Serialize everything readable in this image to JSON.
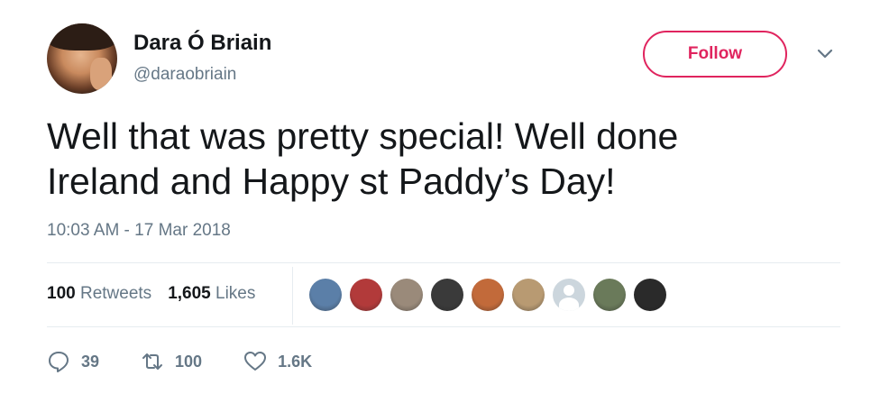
{
  "tweet": {
    "author": {
      "name": "Dara Ó Briain",
      "handle": "@daraobriain"
    },
    "follow_label": "Follow",
    "text_line1": "Well that was pretty special! Well done",
    "text_line2": "Ireland and Happy st Paddy’s Day!",
    "timestamp": "10:03 AM - 17 Mar 2018",
    "stats": {
      "retweets_count": "100",
      "retweets_label": "Retweets",
      "likes_count": "1,605",
      "likes_label": "Likes"
    },
    "liker_avatars": [
      {
        "color": "#5b7fa8"
      },
      {
        "color": "#b23a3a"
      },
      {
        "color": "#9a8a7a"
      },
      {
        "color": "#3a3a3a"
      },
      {
        "color": "#c26a3a"
      },
      {
        "color": "#b89a72"
      },
      {
        "color": "#ccd6dd"
      },
      {
        "color": "#6a7a5a"
      },
      {
        "color": "#2a2a2a"
      }
    ],
    "actions": {
      "replies": "39",
      "retweets": "100",
      "likes": "1.6K"
    }
  },
  "colors": {
    "accent": "#e0245e",
    "secondary_text": "#657786",
    "divider": "#e6ecf0"
  }
}
